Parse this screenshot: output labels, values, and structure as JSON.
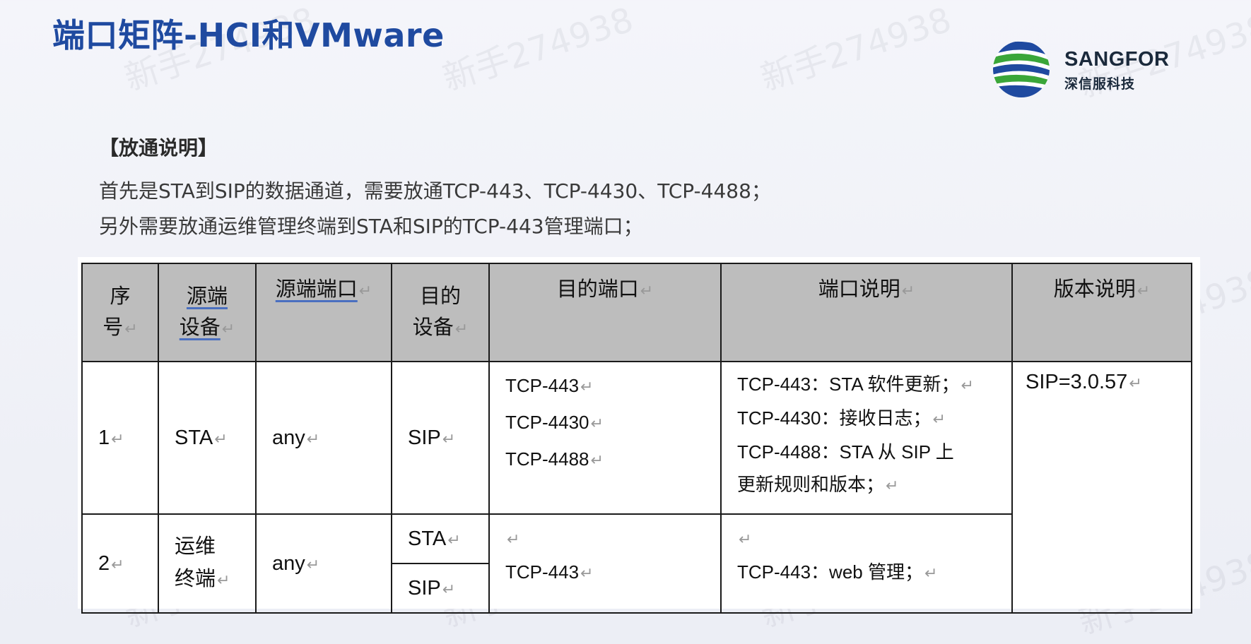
{
  "slide": {
    "title": "端口矩阵-HCI和VMware",
    "logo_text": "SANGFOR",
    "logo_sub": "深信服科技",
    "brand_colors": {
      "blue": "#1f4aa0",
      "green": "#3aa639",
      "navy": "#1b2a3c"
    }
  },
  "notes": {
    "heading": "【放通说明】",
    "lines": [
      "首先是STA到SIP的数据通道，需要放通TCP-443、TCP-4430、TCP-4488；",
      "另外需要放通运维管理终端到STA和SIP的TCP-443管理端口；"
    ]
  },
  "table": {
    "headers": {
      "seq": [
        "序",
        "号"
      ],
      "src_device": [
        "源端",
        "设备"
      ],
      "src_port": "源端端口",
      "dst_device": [
        "目的",
        "设备"
      ],
      "dst_port": "目的端口",
      "port_desc": "端口说明",
      "version": "版本说明"
    },
    "rows": [
      {
        "seq": "1",
        "src_device": "STA",
        "src_port": "any",
        "dst_device": "SIP",
        "dst_ports": [
          "TCP-443",
          "TCP-4430",
          "TCP-4488"
        ],
        "desc": [
          "TCP-443：STA 软件更新；",
          "TCP-4430：接收日志；",
          "TCP-4488：STA 从 SIP 上",
          "更新规则和版本；"
        ],
        "version": "SIP=3.0.57"
      },
      {
        "seq": "2",
        "src_device": [
          "运维",
          "终端"
        ],
        "src_port": "any",
        "dst_devices": [
          "STA",
          "SIP"
        ],
        "dst_port": "TCP-443",
        "desc": "TCP-443：web 管理；"
      }
    ],
    "return_mark": "↵"
  },
  "watermark": "新手274938"
}
